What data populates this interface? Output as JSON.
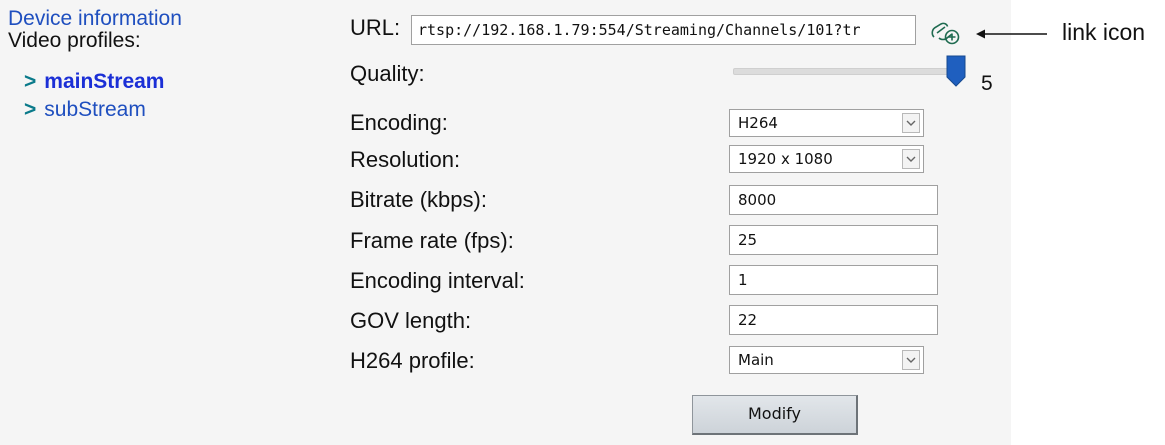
{
  "sidebar": {
    "device_info": "Device information",
    "video_profiles": "Video profiles:",
    "profiles": [
      {
        "label": "mainStream",
        "active": true
      },
      {
        "label": "subStream",
        "active": false
      }
    ]
  },
  "form": {
    "url_label": "URL:",
    "url_value": "rtsp://192.168.1.79:554/Streaming/Channels/101?tr",
    "quality_label": "Quality:",
    "quality_value": "5",
    "encoding_label": "Encoding:",
    "encoding_value": "H264",
    "resolution_label": "Resolution:",
    "resolution_value": "1920 x 1080",
    "bitrate_label": "Bitrate (kbps):",
    "bitrate_value": "8000",
    "framerate_label": "Frame rate (fps):",
    "framerate_value": "25",
    "interval_label": "Encoding interval:",
    "interval_value": "1",
    "gov_label": "GOV length:",
    "gov_value": "22",
    "profile_label": "H264 profile:",
    "profile_value": "Main",
    "modify_button": "Modify"
  },
  "annotation": {
    "text": "link icon"
  },
  "colors": {
    "accent_link": "#1f4fbf",
    "slider_thumb": "#1f5fbf",
    "arrow": "#0a7a8a"
  },
  "icons": [
    "link-icon",
    "chevron-down-icon",
    "slider-thumb-icon"
  ]
}
